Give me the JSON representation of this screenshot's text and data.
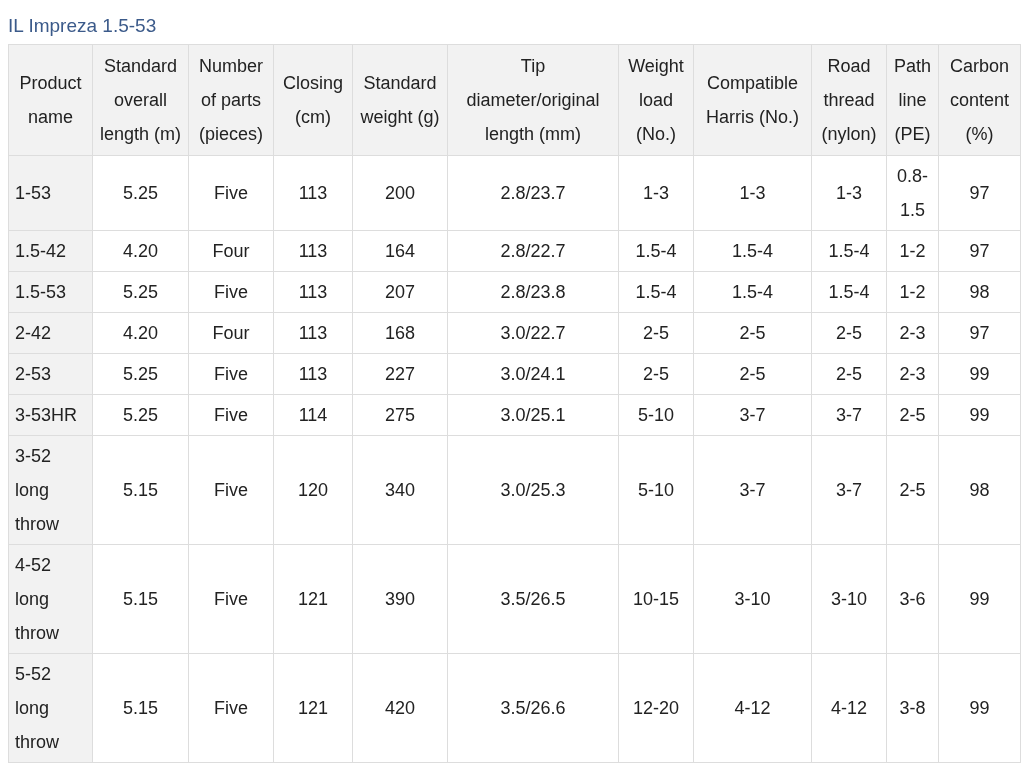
{
  "title": "IL Impreza 1.5-53",
  "table": {
    "columns": [
      "Product name",
      "Standard overall length (m)",
      "Number of parts (pieces)",
      "Closing (cm)",
      "Standard weight (g)",
      "Tip diameter/original length (mm)",
      "Weight load (No.)",
      "Compatible Harris (No.)",
      "Road thread (nylon)",
      "Path line (PE)",
      "Carbon content (%)"
    ],
    "rows": [
      [
        "1-53",
        "5.25",
        "Five",
        "113",
        "200",
        "2.8/23.7",
        "1-3",
        "1-3",
        "1-3",
        "0.8-1.5",
        "97"
      ],
      [
        "1.5-42",
        "4.20",
        "Four",
        "113",
        "164",
        "2.8/22.7",
        "1.5-4",
        "1.5-4",
        "1.5-4",
        "1-2",
        "97"
      ],
      [
        "1.5-53",
        "5.25",
        "Five",
        "113",
        "207",
        "2.8/23.8",
        "1.5-4",
        "1.5-4",
        "1.5-4",
        "1-2",
        "98"
      ],
      [
        "2-42",
        "4.20",
        "Four",
        "113",
        "168",
        "3.0/22.7",
        "2-5",
        "2-5",
        "2-5",
        "2-3",
        "97"
      ],
      [
        "2-53",
        "5.25",
        "Five",
        "113",
        "227",
        "3.0/24.1",
        "2-5",
        "2-5",
        "2-5",
        "2-3",
        "99"
      ],
      [
        "3-53HR",
        "5.25",
        "Five",
        "114",
        "275",
        "3.0/25.1",
        "5-10",
        "3-7",
        "3-7",
        "2-5",
        "99"
      ],
      [
        "3-52 long throw",
        "5.15",
        "Five",
        "120",
        "340",
        "3.0/25.3",
        "5-10",
        "3-7",
        "3-7",
        "2-5",
        "98"
      ],
      [
        "4-52 long throw",
        "5.15",
        "Five",
        "121",
        "390",
        "3.5/26.5",
        "10-15",
        "3-10",
        "3-10",
        "3-6",
        "99"
      ],
      [
        "5-52 long throw",
        "5.15",
        "Five",
        "121",
        "420",
        "3.5/26.6",
        "12-20",
        "4-12",
        "4-12",
        "3-8",
        "99"
      ]
    ]
  }
}
